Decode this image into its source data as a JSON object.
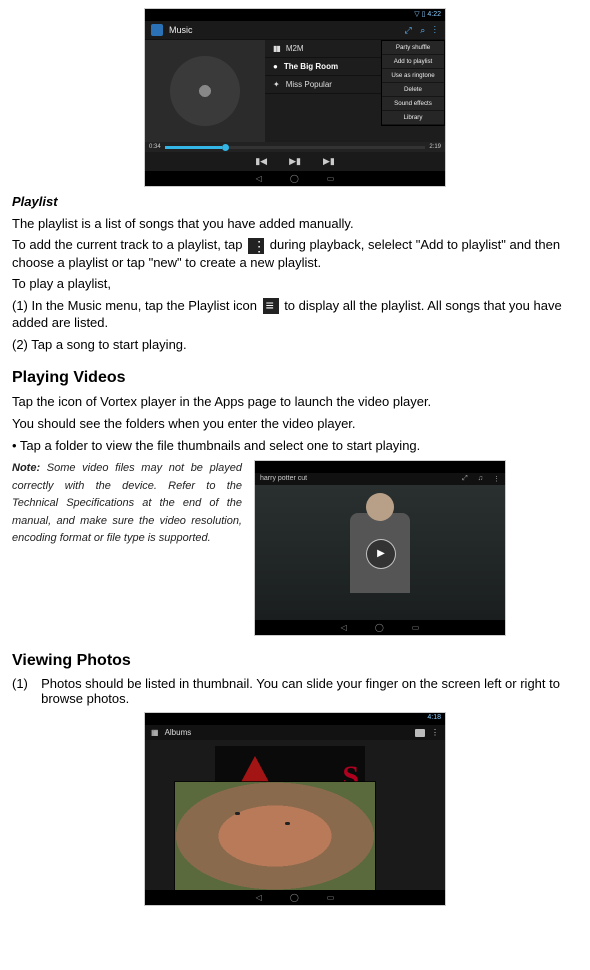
{
  "shot1": {
    "status_icons": "▽ ▯ 4:22",
    "app_title": "Music",
    "top_icons": "⤢  ⌕  ⋮",
    "tracks": [
      {
        "icon": "▮▮",
        "name": "M2M"
      },
      {
        "icon": "●",
        "name": "The Big Room"
      },
      {
        "icon": "✦",
        "name": "Miss Popular"
      }
    ],
    "menu": [
      "Party shuffle",
      "Add to playlist",
      "Use as ringtone",
      "Delete",
      "Sound effects",
      "Library"
    ],
    "time_current": "0:34",
    "time_total": "2:19",
    "controls": {
      "prev": "▮◀",
      "play": "▶▮",
      "next": "▶▮"
    },
    "nav": [
      "◁",
      "◯",
      "▭"
    ]
  },
  "playlist": {
    "heading": "Playlist",
    "intro": "The playlist is a list of songs that you have added manually.",
    "add_pre": "To add the current track to a playlist, tap ",
    "add_post": " during playback, selelect \"Add to playlist\" and then choose a playlist or tap \"new\" to create a new playlist.",
    "play_lead": "To play a playlist,",
    "step1_pre": "(1) In the Music menu, tap the Playlist icon ",
    "step1_post": " to display all the playlist. All songs that you have added are listed.",
    "step2": "(2) Tap a song to start playing."
  },
  "videos": {
    "heading": "Playing Videos",
    "p1": "Tap the icon of Vortex player in the Apps page to launch the video player.",
    "p2": "You should see the folders when you enter the video player.",
    "p3": "•  Tap a folder to view the file thumbnails and select one to start playing.",
    "note_label": "Note:",
    "note_body": " Some video files may not be played correctly with the device. Refer to the Technical Specifications at the end of the manual, and make sure the video resolution, encoding format or file type is supported.",
    "vid_title": "harry potter cut",
    "vid_icons": [
      "⤢",
      "♫",
      "⋮"
    ]
  },
  "photos": {
    "heading": "Viewing Photos",
    "num": "(1)",
    "p1": "Photos should be listed in thumbnail. You can slide your finger on the screen left or right to browse photos.",
    "album_label": "Albums",
    "status_icons": "4:18"
  }
}
